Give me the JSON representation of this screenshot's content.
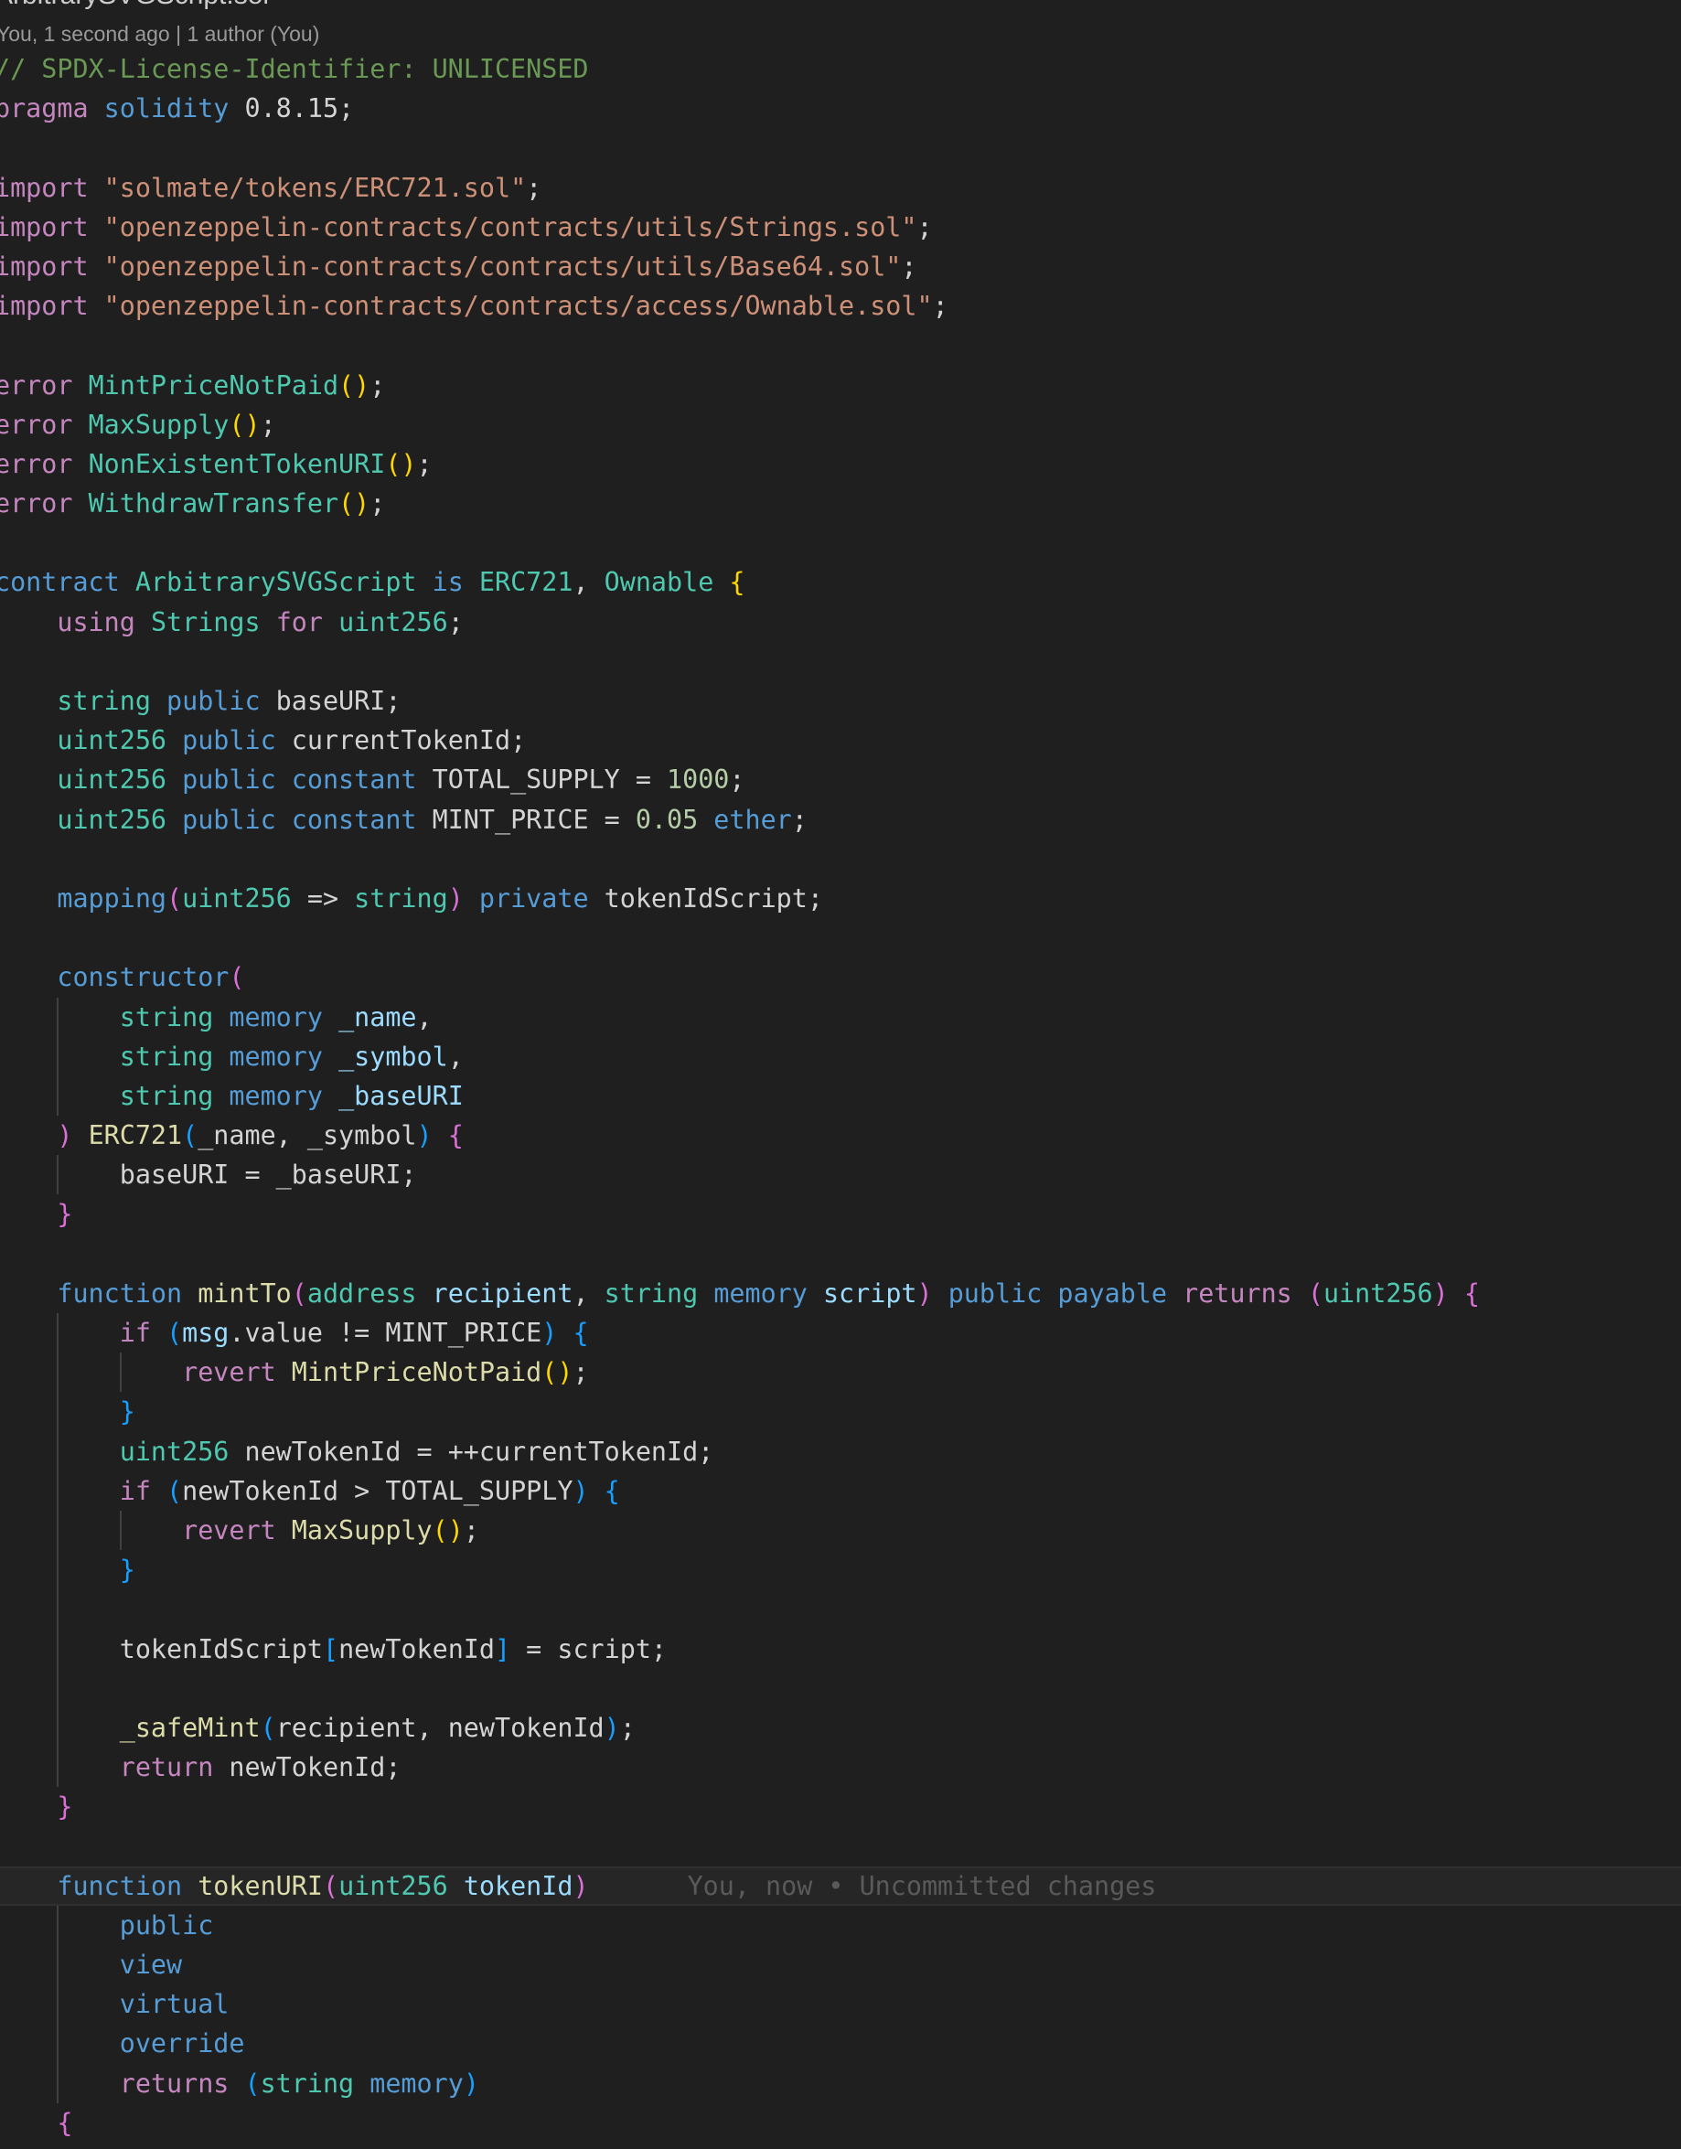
{
  "editor": {
    "file_title": "ArbitrarySVGScript.sol",
    "blame_header": "You, 1 second ago | 1 author (You)",
    "inline_blame": "You, now • Uncommitted changes"
  },
  "colors": {
    "cm": "#6A9955",
    "kw": "#C586C0",
    "bl": "#569CD6",
    "st": "#CE9178",
    "ty": "#4EC9B0",
    "fn": "#DCDCAA",
    "va": "#9CDCFE",
    "nu": "#B5CEA8",
    "tx": "#D4D4D4",
    "b1": "#FFD700",
    "b2": "#DA70D6",
    "b3": "#179FFF"
  },
  "lines": [
    {
      "i": 0,
      "t": [
        [
          "cm",
          "// SPDX-License-Identifier: UNLICENSED"
        ]
      ]
    },
    {
      "i": 0,
      "t": [
        [
          "kw",
          "pragma"
        ],
        [
          "tx",
          " "
        ],
        [
          "bl",
          "solidity"
        ],
        [
          "tx",
          " 0.8.15;"
        ]
      ]
    },
    {
      "i": 0,
      "t": []
    },
    {
      "i": 0,
      "t": [
        [
          "kw",
          "import"
        ],
        [
          "tx",
          " "
        ],
        [
          "st",
          "\"solmate/tokens/ERC721.sol\""
        ],
        [
          "tx",
          ";"
        ]
      ]
    },
    {
      "i": 0,
      "t": [
        [
          "kw",
          "import"
        ],
        [
          "tx",
          " "
        ],
        [
          "st",
          "\"openzeppelin-contracts/contracts/utils/Strings.sol\""
        ],
        [
          "tx",
          ";"
        ]
      ]
    },
    {
      "i": 0,
      "t": [
        [
          "kw",
          "import"
        ],
        [
          "tx",
          " "
        ],
        [
          "st",
          "\"openzeppelin-contracts/contracts/utils/Base64.sol\""
        ],
        [
          "tx",
          ";"
        ]
      ]
    },
    {
      "i": 0,
      "t": [
        [
          "kw",
          "import"
        ],
        [
          "tx",
          " "
        ],
        [
          "st",
          "\"openzeppelin-contracts/contracts/access/Ownable.sol\""
        ],
        [
          "tx",
          ";"
        ]
      ]
    },
    {
      "i": 0,
      "t": []
    },
    {
      "i": 0,
      "t": [
        [
          "kw",
          "error"
        ],
        [
          "tx",
          " "
        ],
        [
          "ty",
          "MintPriceNotPaid"
        ],
        [
          "b1",
          "()"
        ],
        [
          "tx",
          ";"
        ]
      ]
    },
    {
      "i": 0,
      "t": [
        [
          "kw",
          "error"
        ],
        [
          "tx",
          " "
        ],
        [
          "ty",
          "MaxSupply"
        ],
        [
          "b1",
          "()"
        ],
        [
          "tx",
          ";"
        ]
      ]
    },
    {
      "i": 0,
      "t": [
        [
          "kw",
          "error"
        ],
        [
          "tx",
          " "
        ],
        [
          "ty",
          "NonExistentTokenURI"
        ],
        [
          "b1",
          "()"
        ],
        [
          "tx",
          ";"
        ]
      ]
    },
    {
      "i": 0,
      "t": [
        [
          "kw",
          "error"
        ],
        [
          "tx",
          " "
        ],
        [
          "ty",
          "WithdrawTransfer"
        ],
        [
          "b1",
          "()"
        ],
        [
          "tx",
          ";"
        ]
      ]
    },
    {
      "i": 0,
      "t": []
    },
    {
      "i": 0,
      "t": [
        [
          "bl",
          "contract"
        ],
        [
          "tx",
          " "
        ],
        [
          "ty",
          "ArbitrarySVGScript"
        ],
        [
          "tx",
          " "
        ],
        [
          "bl",
          "is"
        ],
        [
          "tx",
          " "
        ],
        [
          "ty",
          "ERC721"
        ],
        [
          "tx",
          ", "
        ],
        [
          "ty",
          "Ownable"
        ],
        [
          "tx",
          " "
        ],
        [
          "b1",
          "{"
        ]
      ]
    },
    {
      "i": 1,
      "t": [
        [
          "kw",
          "using"
        ],
        [
          "tx",
          " "
        ],
        [
          "ty",
          "Strings"
        ],
        [
          "tx",
          " "
        ],
        [
          "kw",
          "for"
        ],
        [
          "tx",
          " "
        ],
        [
          "ty",
          "uint256"
        ],
        [
          "tx",
          ";"
        ]
      ]
    },
    {
      "i": 0,
      "t": []
    },
    {
      "i": 1,
      "t": [
        [
          "ty",
          "string"
        ],
        [
          "tx",
          " "
        ],
        [
          "bl",
          "public"
        ],
        [
          "tx",
          " baseURI;"
        ]
      ]
    },
    {
      "i": 1,
      "t": [
        [
          "ty",
          "uint256"
        ],
        [
          "tx",
          " "
        ],
        [
          "bl",
          "public"
        ],
        [
          "tx",
          " currentTokenId;"
        ]
      ]
    },
    {
      "i": 1,
      "t": [
        [
          "ty",
          "uint256"
        ],
        [
          "tx",
          " "
        ],
        [
          "bl",
          "public"
        ],
        [
          "tx",
          " "
        ],
        [
          "bl",
          "constant"
        ],
        [
          "tx",
          " TOTAL_SUPPLY = "
        ],
        [
          "nu",
          "1000"
        ],
        [
          "tx",
          ";"
        ]
      ]
    },
    {
      "i": 1,
      "t": [
        [
          "ty",
          "uint256"
        ],
        [
          "tx",
          " "
        ],
        [
          "bl",
          "public"
        ],
        [
          "tx",
          " "
        ],
        [
          "bl",
          "constant"
        ],
        [
          "tx",
          " MINT_PRICE = "
        ],
        [
          "nu",
          "0.05"
        ],
        [
          "tx",
          " "
        ],
        [
          "bl",
          "ether"
        ],
        [
          "tx",
          ";"
        ]
      ]
    },
    {
      "i": 0,
      "t": []
    },
    {
      "i": 1,
      "t": [
        [
          "bl",
          "mapping"
        ],
        [
          "b2",
          "("
        ],
        [
          "ty",
          "uint256"
        ],
        [
          "tx",
          " => "
        ],
        [
          "ty",
          "string"
        ],
        [
          "b2",
          ")"
        ],
        [
          "tx",
          " "
        ],
        [
          "bl",
          "private"
        ],
        [
          "tx",
          " tokenIdScript;"
        ]
      ]
    },
    {
      "i": 0,
      "t": []
    },
    {
      "i": 1,
      "t": [
        [
          "bl",
          "constructor"
        ],
        [
          "b2",
          "("
        ]
      ]
    },
    {
      "i": 2,
      "t": [
        [
          "ty",
          "string"
        ],
        [
          "tx",
          " "
        ],
        [
          "bl",
          "memory"
        ],
        [
          "tx",
          " "
        ],
        [
          "va",
          "_name"
        ],
        [
          "tx",
          ","
        ]
      ]
    },
    {
      "i": 2,
      "t": [
        [
          "ty",
          "string"
        ],
        [
          "tx",
          " "
        ],
        [
          "bl",
          "memory"
        ],
        [
          "tx",
          " "
        ],
        [
          "va",
          "_symbol"
        ],
        [
          "tx",
          ","
        ]
      ]
    },
    {
      "i": 2,
      "t": [
        [
          "ty",
          "string"
        ],
        [
          "tx",
          " "
        ],
        [
          "bl",
          "memory"
        ],
        [
          "tx",
          " "
        ],
        [
          "va",
          "_baseURI"
        ]
      ]
    },
    {
      "i": 1,
      "t": [
        [
          "b2",
          ")"
        ],
        [
          "tx",
          " "
        ],
        [
          "fn",
          "ERC721"
        ],
        [
          "b3",
          "("
        ],
        [
          "tx",
          "_name, _symbol"
        ],
        [
          "b3",
          ")"
        ],
        [
          "tx",
          " "
        ],
        [
          "b2",
          "{"
        ]
      ]
    },
    {
      "i": 2,
      "t": [
        [
          "tx",
          "baseURI = _baseURI;"
        ]
      ]
    },
    {
      "i": 1,
      "t": [
        [
          "b2",
          "}"
        ]
      ]
    },
    {
      "i": 0,
      "t": []
    },
    {
      "i": 1,
      "t": [
        [
          "bl",
          "function"
        ],
        [
          "tx",
          " "
        ],
        [
          "fn",
          "mintTo"
        ],
        [
          "b2",
          "("
        ],
        [
          "ty",
          "address"
        ],
        [
          "tx",
          " "
        ],
        [
          "va",
          "recipient"
        ],
        [
          "tx",
          ", "
        ],
        [
          "ty",
          "string"
        ],
        [
          "tx",
          " "
        ],
        [
          "bl",
          "memory"
        ],
        [
          "tx",
          " "
        ],
        [
          "va",
          "script"
        ],
        [
          "b2",
          ")"
        ],
        [
          "tx",
          " "
        ],
        [
          "bl",
          "public"
        ],
        [
          "tx",
          " "
        ],
        [
          "bl",
          "payable"
        ],
        [
          "tx",
          " "
        ],
        [
          "kw",
          "returns"
        ],
        [
          "tx",
          " "
        ],
        [
          "b2",
          "("
        ],
        [
          "ty",
          "uint256"
        ],
        [
          "b2",
          ")"
        ],
        [
          "tx",
          " "
        ],
        [
          "b2",
          "{"
        ]
      ]
    },
    {
      "i": 2,
      "t": [
        [
          "kw",
          "if"
        ],
        [
          "tx",
          " "
        ],
        [
          "b3",
          "("
        ],
        [
          "va",
          "msg"
        ],
        [
          "tx",
          ".value != MINT_PRICE"
        ],
        [
          "b3",
          ")"
        ],
        [
          "tx",
          " "
        ],
        [
          "b3",
          "{"
        ]
      ]
    },
    {
      "i": 3,
      "t": [
        [
          "kw",
          "revert"
        ],
        [
          "tx",
          " "
        ],
        [
          "fn",
          "MintPriceNotPaid"
        ],
        [
          "b1",
          "()"
        ],
        [
          "tx",
          ";"
        ]
      ]
    },
    {
      "i": 2,
      "t": [
        [
          "b3",
          "}"
        ]
      ]
    },
    {
      "i": 2,
      "t": [
        [
          "ty",
          "uint256"
        ],
        [
          "tx",
          " newTokenId = ++currentTokenId;"
        ]
      ]
    },
    {
      "i": 2,
      "t": [
        [
          "kw",
          "if"
        ],
        [
          "tx",
          " "
        ],
        [
          "b3",
          "("
        ],
        [
          "tx",
          "newTokenId > TOTAL_SUPPLY"
        ],
        [
          "b3",
          ")"
        ],
        [
          "tx",
          " "
        ],
        [
          "b3",
          "{"
        ]
      ]
    },
    {
      "i": 3,
      "t": [
        [
          "kw",
          "revert"
        ],
        [
          "tx",
          " "
        ],
        [
          "fn",
          "MaxSupply"
        ],
        [
          "b1",
          "()"
        ],
        [
          "tx",
          ";"
        ]
      ]
    },
    {
      "i": 2,
      "t": [
        [
          "b3",
          "}"
        ]
      ]
    },
    {
      "i": 2,
      "e": true,
      "t": []
    },
    {
      "i": 2,
      "t": [
        [
          "tx",
          "tokenIdScript"
        ],
        [
          "b3",
          "["
        ],
        [
          "tx",
          "newTokenId"
        ],
        [
          "b3",
          "]"
        ],
        [
          "tx",
          " = script;"
        ]
      ]
    },
    {
      "i": 2,
      "e": true,
      "t": []
    },
    {
      "i": 2,
      "t": [
        [
          "fn",
          "_safeMint"
        ],
        [
          "b3",
          "("
        ],
        [
          "tx",
          "recipient, newTokenId"
        ],
        [
          "b3",
          ")"
        ],
        [
          "tx",
          ";"
        ]
      ]
    },
    {
      "i": 2,
      "t": [
        [
          "kw",
          "return"
        ],
        [
          "tx",
          " newTokenId;"
        ]
      ]
    },
    {
      "i": 1,
      "t": [
        [
          "b2",
          "}"
        ]
      ]
    },
    {
      "i": 0,
      "t": []
    },
    {
      "i": 1,
      "current": true,
      "t": [
        [
          "bl",
          "function"
        ],
        [
          "tx",
          " "
        ],
        [
          "fn",
          "tokenURI"
        ],
        [
          "b2",
          "("
        ],
        [
          "ty",
          "uint256"
        ],
        [
          "tx",
          " "
        ],
        [
          "va",
          "tokenId"
        ],
        [
          "b2",
          ")"
        ]
      ]
    },
    {
      "i": 2,
      "t": [
        [
          "bl",
          "public"
        ]
      ]
    },
    {
      "i": 2,
      "t": [
        [
          "bl",
          "view"
        ]
      ]
    },
    {
      "i": 2,
      "t": [
        [
          "bl",
          "virtual"
        ]
      ]
    },
    {
      "i": 2,
      "t": [
        [
          "bl",
          "override"
        ]
      ]
    },
    {
      "i": 2,
      "t": [
        [
          "kw",
          "returns"
        ],
        [
          "tx",
          " "
        ],
        [
          "b3",
          "("
        ],
        [
          "ty",
          "string"
        ],
        [
          "tx",
          " "
        ],
        [
          "bl",
          "memory"
        ],
        [
          "b3",
          ")"
        ]
      ]
    },
    {
      "i": 1,
      "t": [
        [
          "b2",
          "{"
        ]
      ]
    }
  ]
}
